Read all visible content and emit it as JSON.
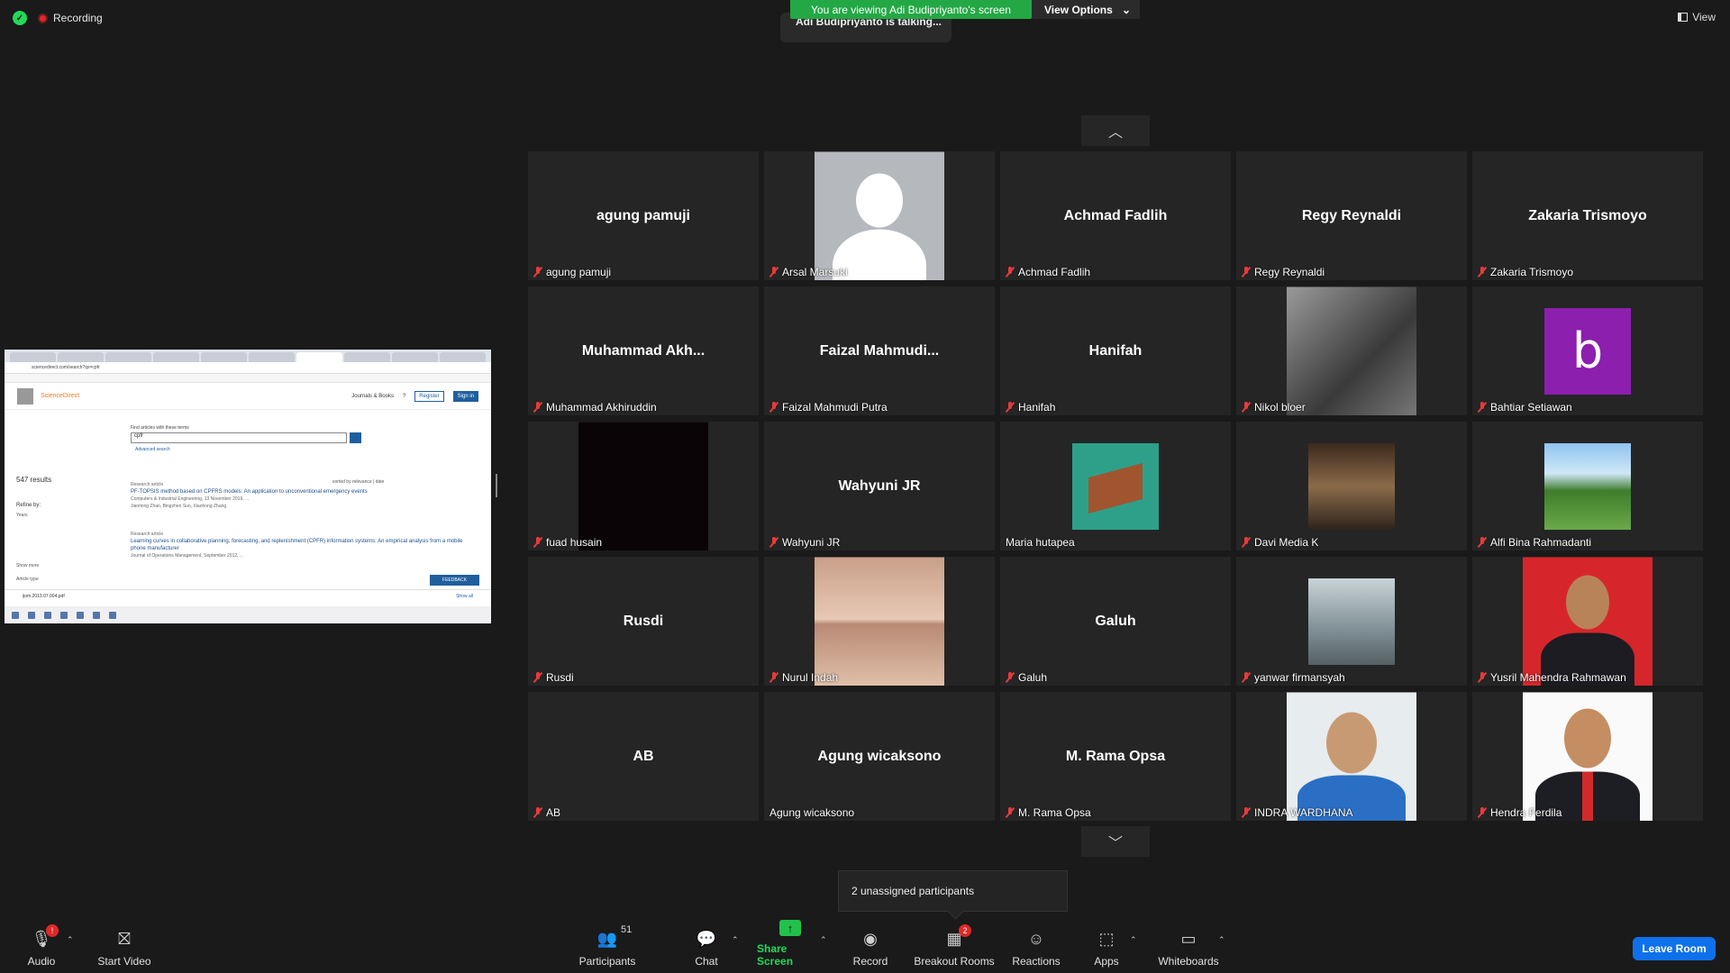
{
  "top": {
    "recording": "Recording",
    "viewing_banner": "You are viewing Adi Budipriyanto's screen",
    "view_options": "View Options",
    "talking": "Adi Budipriyanto is talking...",
    "view": "View"
  },
  "shared_screen": {
    "url": "sciencedirect.com/search?qs=cpfr",
    "site_name": "ScienceDirect",
    "journals": "Journals & Books",
    "register": "Register",
    "sign_in": "Sign in",
    "search_label": "Find articles with these terms",
    "search_value": "cpfr",
    "advanced": "Advanced search",
    "results": "547 results",
    "sorted": "sorted by relevance | date",
    "refine": "Refine by:",
    "years": "Years",
    "article1_type": "Research article",
    "article1_title": "PF-TOPSIS method based on CPFRS models: An application to unconventional emergency events",
    "article1_meta": "Computers & Industrial Engineering, 13 November 2019, ...",
    "article1_authors": "Jianming Zhan, Bingzhen Sun, Xiaohong Zhang",
    "article2_type": "Research article",
    "article2_title": "Learning curves in collaborative planning, forecasting, and replenishment (CPFR) information systems: An empirical analysis from a mobile phone manufacturer",
    "article2_meta": "Journal of Operations Management, September 2012, ...",
    "show_more": "Show more",
    "article_type": "Article type",
    "feedback": "FEEDBACK",
    "download": "ijom.2013.07.004.pdf",
    "show_all": "Show all"
  },
  "tiles": [
    {
      "big": "agung pamuji",
      "label": "agung pamuji",
      "muted": true,
      "pic": ""
    },
    {
      "big": "",
      "label": "Arsal Marsuki",
      "muted": true,
      "pic": "avatar-gen"
    },
    {
      "big": "Achmad Fadlih",
      "label": "Achmad Fadlih",
      "muted": true,
      "pic": ""
    },
    {
      "big": "Regy Reynaldi",
      "label": "Regy Reynaldi",
      "muted": true,
      "pic": ""
    },
    {
      "big": "Zakaria Trismoyo",
      "label": "Zakaria Trismoyo",
      "muted": true,
      "pic": ""
    },
    {
      "big": "Muhammad  Akh...",
      "label": "Muhammad Akhiruddin",
      "muted": true,
      "pic": ""
    },
    {
      "big": "Faizal  Mahmudi...",
      "label": "Faizal Mahmudi Putra",
      "muted": true,
      "pic": ""
    },
    {
      "big": "Hanifah",
      "label": "Hanifah",
      "muted": true,
      "pic": ""
    },
    {
      "big": "",
      "label": "Nikol bloer",
      "muted": true,
      "pic": "ph-bw"
    },
    {
      "big": "",
      "label": "Bahtiar Setiawan",
      "muted": true,
      "pic": "ph-b",
      "pic_text": "b"
    },
    {
      "big": "",
      "label": "fuad husain",
      "muted": true,
      "pic": "ph-dark"
    },
    {
      "big": "Wahyuni JR",
      "label": "Wahyuni JR",
      "muted": true,
      "pic": ""
    },
    {
      "big": "",
      "label": "Maria hutapea",
      "muted": false,
      "pic": "ph-piano"
    },
    {
      "big": "",
      "label": "Davi Media K",
      "muted": true,
      "pic": "ph-cafe"
    },
    {
      "big": "",
      "label": "Alfi Bina Rahmadanti",
      "muted": true,
      "pic": "ph-park"
    },
    {
      "big": "Rusdi",
      "label": "Rusdi",
      "muted": true,
      "pic": ""
    },
    {
      "big": "",
      "label": "Nurul Indah",
      "muted": true,
      "pic": "ph-girls"
    },
    {
      "big": "Galuh",
      "label": "Galuh",
      "muted": true,
      "pic": ""
    },
    {
      "big": "",
      "label": "yanwar firmansyah",
      "muted": true,
      "pic": "ph-cloud"
    },
    {
      "big": "",
      "label": "Yusril Mahendra Rahmawan",
      "muted": true,
      "pic": "ph-red"
    },
    {
      "big": "AB",
      "label": "AB",
      "muted": true,
      "pic": ""
    },
    {
      "big": "Agung wicaksono",
      "label": "Agung wicaksono",
      "muted": false,
      "pic": ""
    },
    {
      "big": "M. Rama Opsa",
      "label": "M. Rama Opsa",
      "muted": true,
      "pic": ""
    },
    {
      "big": "",
      "label": "INDRA WARDHANA",
      "muted": true,
      "pic": "ph-indra"
    },
    {
      "big": "",
      "label": "Hendra Ferdila",
      "muted": true,
      "pic": "ph-hendra"
    }
  ],
  "tooltip": "2 unassigned participants",
  "toolbar": {
    "audio": "Audio",
    "audio_badge": "!",
    "start_video": "Start Video",
    "participants": "Participants",
    "participants_count": "51",
    "chat": "Chat",
    "share_screen": "Share Screen",
    "record": "Record",
    "breakout": "Breakout Rooms",
    "breakout_badge": "2",
    "reactions": "Reactions",
    "apps": "Apps",
    "whiteboards": "Whiteboards",
    "leave": "Leave Room"
  },
  "colors": {
    "accent_green": "#23a845",
    "leave_blue": "#0e71eb",
    "muted_red": "#e83a3a"
  }
}
